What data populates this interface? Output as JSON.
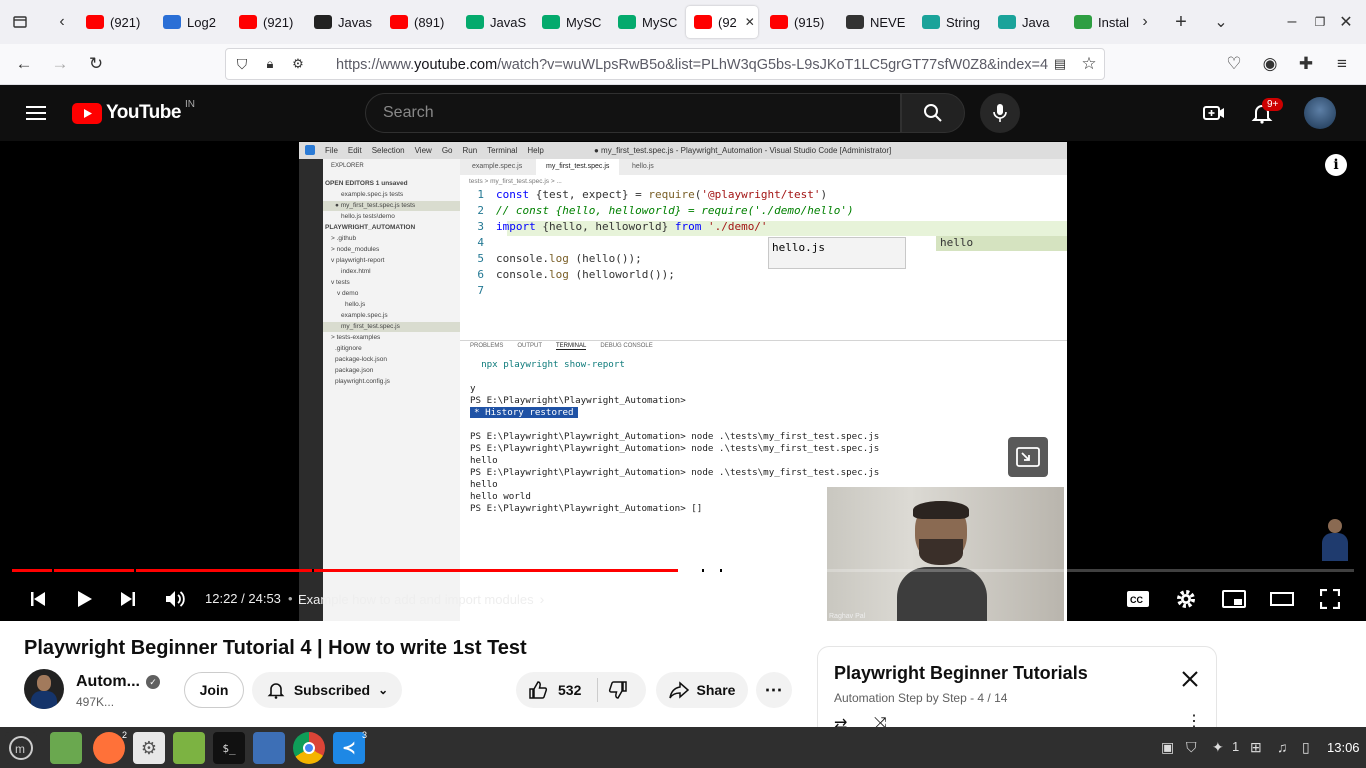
{
  "browser": {
    "tabs": [
      {
        "label": "(921)",
        "icon": "youtube-icon",
        "color": "#ff0000"
      },
      {
        "label": "Log2",
        "icon": "log2-icon",
        "color": "#2a6fd6"
      },
      {
        "label": "(921)",
        "icon": "youtube-icon",
        "color": "#ff0000"
      },
      {
        "label": "Javas",
        "icon": "github-icon",
        "color": "#222222"
      },
      {
        "label": "(891)",
        "icon": "youtube-icon",
        "color": "#ff0000"
      },
      {
        "label": "JavaS",
        "icon": "w3schools-icon",
        "color": "#04aa6d"
      },
      {
        "label": "MySC",
        "icon": "w3schools-icon",
        "color": "#04aa6d"
      },
      {
        "label": "MySC",
        "icon": "w3schools-icon",
        "color": "#04aa6d"
      },
      {
        "label": "(92",
        "icon": "youtube-icon",
        "color": "#ff0000",
        "active": true
      },
      {
        "label": "(915)",
        "icon": "youtube-icon",
        "color": "#ff0000"
      },
      {
        "label": "NEVE",
        "icon": "triangle-icon",
        "color": "#333333"
      },
      {
        "label": "String",
        "icon": "jetbrains-icon",
        "color": "#1aa39a"
      },
      {
        "label": "Java",
        "icon": "jetbrains-icon",
        "color": "#1aa39a"
      },
      {
        "label": "Instal",
        "icon": "leaf-icon",
        "color": "#2e9e42"
      }
    ],
    "url_prefix": "https://www.",
    "url_domain": "youtube.com",
    "url_rest": "/watch?v=wuWLpsRwB5o&list=PLhW3qG5bs-L9sJKoT1LC5grGT77sfW0Z8&index=4"
  },
  "youtube": {
    "logo_text": "YouTube",
    "region": "IN",
    "search_placeholder": "Search",
    "notifications": "9+"
  },
  "vscode": {
    "title": "● my_first_test.spec.js - Playwright_Automation - Visual Studio Code [Administrator]",
    "menu": [
      "File",
      "Edit",
      "Selection",
      "View",
      "Go",
      "Run",
      "Terminal",
      "Help"
    ],
    "tabs": [
      "example.spec.js",
      "my_first_test.spec.js",
      "hello.js"
    ],
    "breadcrumb": "tests > my_first_test.spec.js > ...",
    "explorer_header": "EXPLORER",
    "explorer": [
      {
        "text": "OPEN EDITORS  1 unsaved",
        "indent": 2,
        "bold": true
      },
      {
        "text": "example.spec.js  tests",
        "indent": 18
      },
      {
        "text": "● my_first_test.spec.js  tests",
        "indent": 12,
        "selected": true
      },
      {
        "text": "hello.js  tests\\demo",
        "indent": 18
      },
      {
        "text": "PLAYWRIGHT_AUTOMATION",
        "indent": 2,
        "bold": true
      },
      {
        "text": "> .github",
        "indent": 8
      },
      {
        "text": "> node_modules",
        "indent": 8
      },
      {
        "text": "v playwright-report",
        "indent": 8
      },
      {
        "text": "index.html",
        "indent": 18
      },
      {
        "text": "v tests",
        "indent": 8
      },
      {
        "text": "v demo",
        "indent": 14
      },
      {
        "text": "hello.js",
        "indent": 22
      },
      {
        "text": "example.spec.js",
        "indent": 18
      },
      {
        "text": "my_first_test.spec.js",
        "indent": 18,
        "selected": true
      },
      {
        "text": "> tests-examples",
        "indent": 8
      },
      {
        "text": ".gitignore",
        "indent": 12
      },
      {
        "text": "package-lock.json",
        "indent": 12
      },
      {
        "text": "package.json",
        "indent": 12
      },
      {
        "text": "playwright.config.js",
        "indent": 12
      }
    ],
    "code_lines": [
      "const {test, expect} = require('@playwright/test')",
      "// const {hello, helloworld} = require('./demo/hello')",
      "import {hello, helloworld} from './demo/'",
      "",
      "console.log (hello());",
      "console.log (helloworld());",
      ""
    ],
    "suggest_item": "hello.js",
    "suggest_preview": "hello",
    "panel_tabs": [
      "PROBLEMS",
      "OUTPUT",
      "TERMINAL",
      "DEBUG CONSOLE"
    ],
    "terminal": [
      "  npx playwright show-report",
      "",
      "y",
      "PS E:\\Playwright\\Playwright_Automation>",
      "* History restored",
      "",
      "PS E:\\Playwright\\Playwright_Automation> node .\\tests\\my_first_test.spec.js",
      "PS E:\\Playwright\\Playwright_Automation> node .\\tests\\my_first_test.spec.js",
      "hello",
      "PS E:\\Playwright\\Playwright_Automation> node .\\tests\\my_first_test.spec.js",
      "hello",
      "hello world",
      "PS E:\\Playwright\\Playwright_Automation> []"
    ],
    "webcam_label": "Raghav Pal"
  },
  "player": {
    "progress": 0.496,
    "time": "12:22 / 24:53",
    "separator": "•",
    "chapter": "Example how to add and import modules"
  },
  "video": {
    "title": "Playwright Beginner Tutorial 4 | How to write 1st Test",
    "channel": "Autom...",
    "subs": "497K...",
    "join": "Join",
    "subscribed": "Subscribed",
    "likes": "532",
    "share": "Share"
  },
  "playlist": {
    "title": "Playwright Beginner Tutorials",
    "subtitle": "Automation Step by Step - 4 / 14"
  },
  "taskbar": {
    "apps": [
      {
        "name": "mint-menu-icon",
        "color": "#2f2f2f"
      },
      {
        "name": "files-icon",
        "color": "#6aa84f"
      },
      {
        "name": "firefox-icon",
        "color": "#ff7139",
        "badge": "2"
      },
      {
        "name": "settings-icon",
        "color": "#e8e8e8"
      },
      {
        "name": "folder-icon",
        "color": "#7cb342"
      },
      {
        "name": "terminal-icon",
        "color": "#111111"
      },
      {
        "name": "screenshot-icon",
        "color": "#3d6fb6"
      },
      {
        "name": "chrome-icon",
        "color": "#dddddd"
      },
      {
        "name": "vscode-icon",
        "color": "#1e88e5",
        "badge": "3"
      }
    ],
    "tray_count": "1",
    "clock": "13:06"
  }
}
